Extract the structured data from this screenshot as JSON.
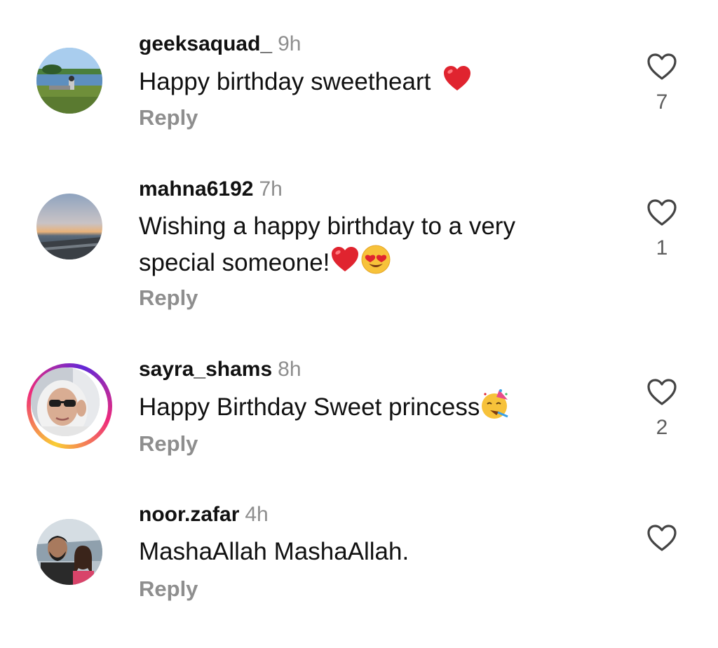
{
  "comments": [
    {
      "username": "geeksaquad_",
      "time": "9h",
      "text": "Happy birthday sweetheart",
      "emoji_after": "red-heart",
      "reply_label": "Reply",
      "likes": "7",
      "avatar": "lake-landscape-photo"
    },
    {
      "username": "mahna6192",
      "time": "7h",
      "text_line1": "Wishing a happy birthday to a very",
      "text_line2": "special someone!",
      "emoji_after": [
        "red-heart",
        "heart-eyes-face"
      ],
      "reply_label": "Reply",
      "likes": "1",
      "avatar": "sunset-beach-photo"
    },
    {
      "username": "sayra_shams",
      "time": "8h",
      "text": "Happy Birthday Sweet princess",
      "emoji_after": "partying-face",
      "reply_label": "Reply",
      "likes": "2",
      "avatar": "woman-sunglasses-photo",
      "has_story_ring": true
    },
    {
      "username": "noor.zafar",
      "time": "4h",
      "text": "MashaAllah MashaAllah.",
      "reply_label": "Reply",
      "likes": "",
      "avatar": "couple-selfie-photo"
    }
  ],
  "colors": {
    "secondary_text": "#8e8e8e",
    "primary_text": "#111111",
    "heart_red": "#e0242f",
    "story_ring": [
      "#f9ce34",
      "#ee2a7b",
      "#6228d7"
    ]
  }
}
